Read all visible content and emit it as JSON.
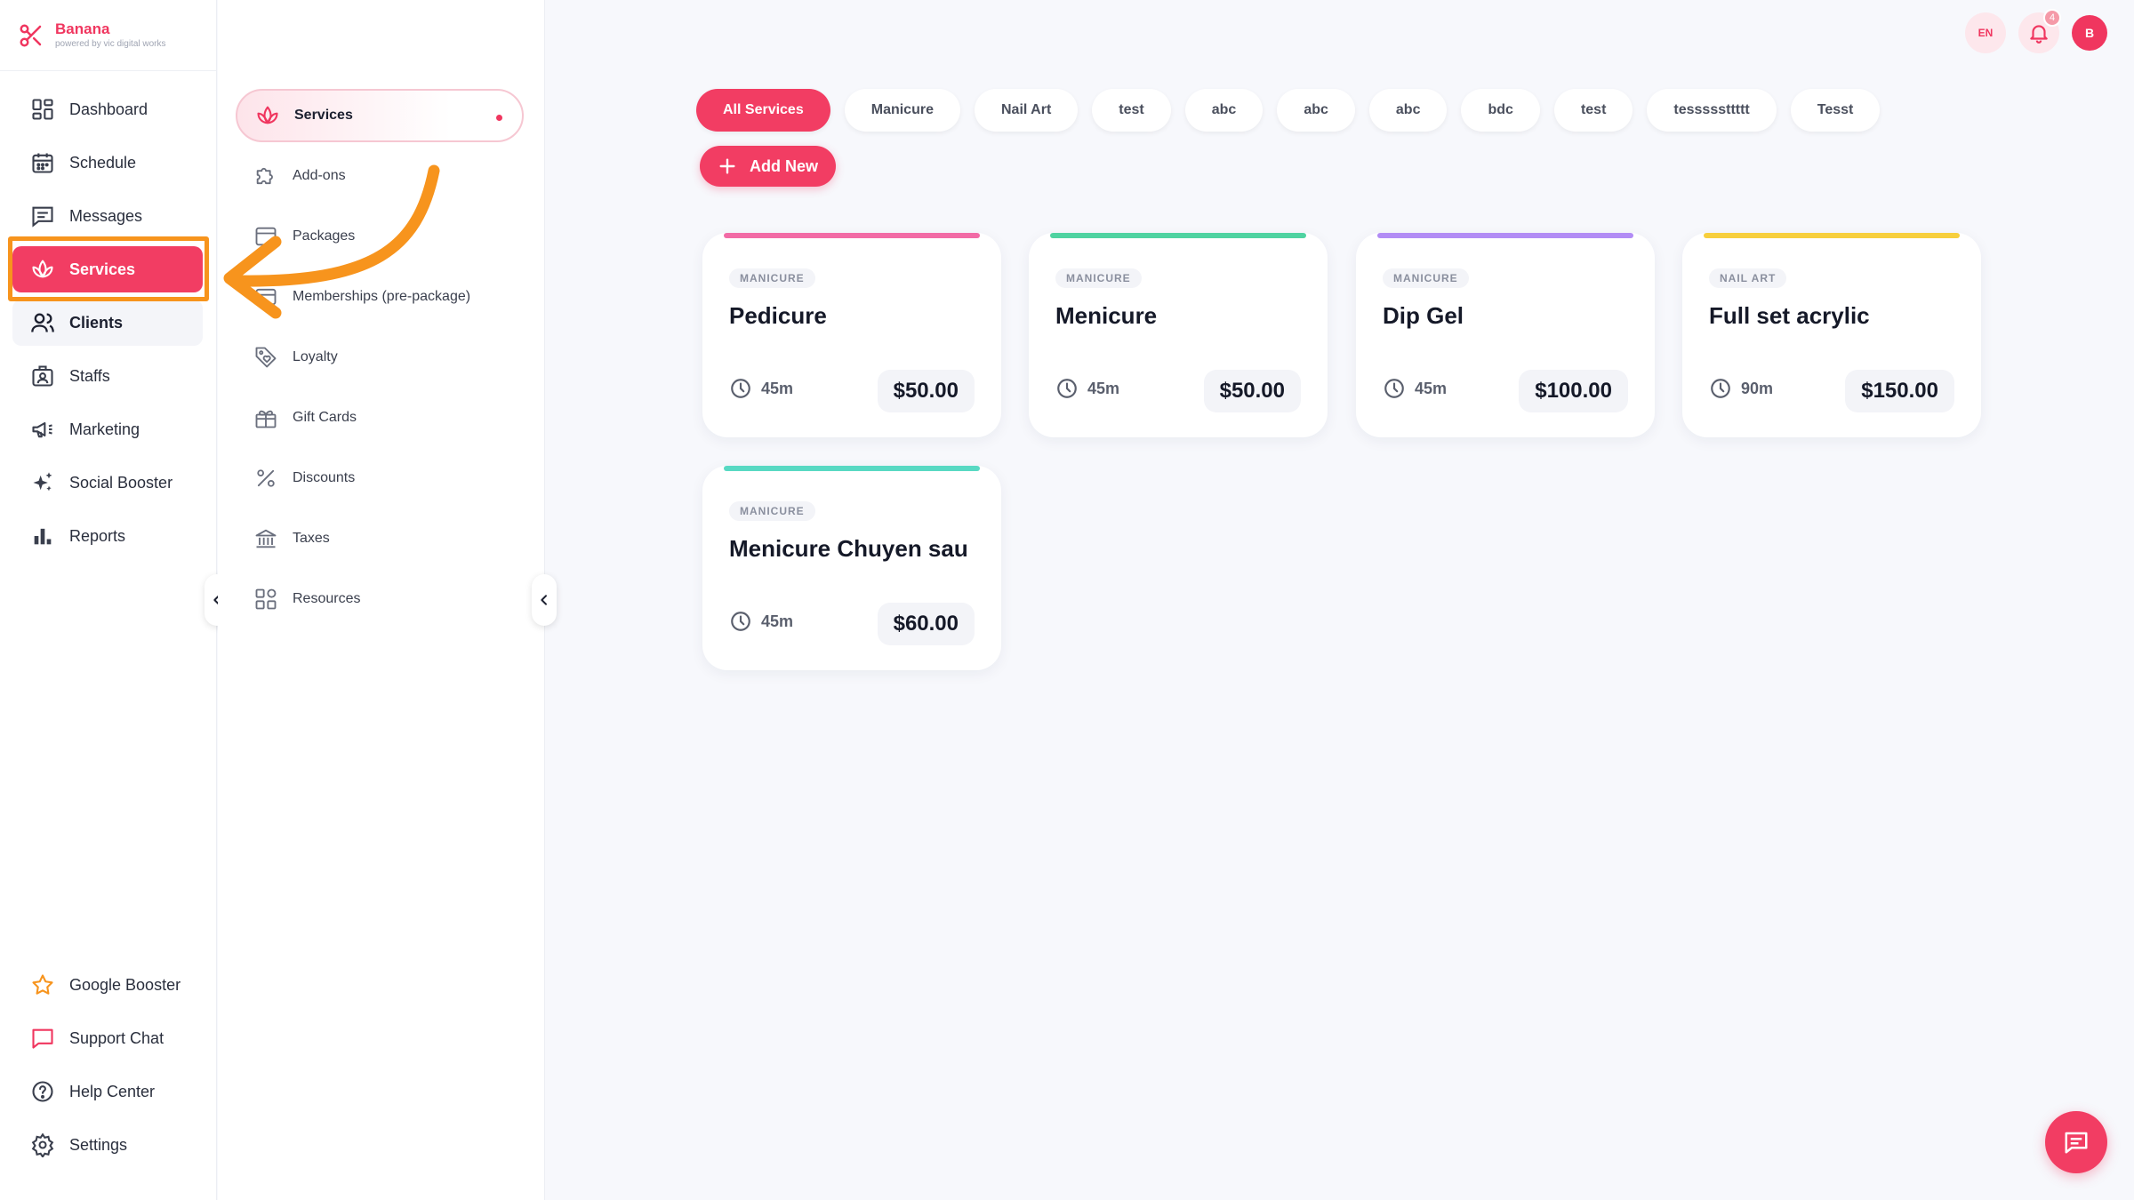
{
  "brand": {
    "name": "Banana",
    "tagline": "powered by vic digital works"
  },
  "sidebar": {
    "items": [
      {
        "label": "Dashboard",
        "icon": "dashboard-icon"
      },
      {
        "label": "Schedule",
        "icon": "calendar-icon"
      },
      {
        "label": "Messages",
        "icon": "message-icon"
      },
      {
        "label": "Services",
        "icon": "lotus-icon"
      },
      {
        "label": "Clients",
        "icon": "users-icon"
      },
      {
        "label": "Staffs",
        "icon": "staff-icon"
      },
      {
        "label": "Marketing",
        "icon": "megaphone-icon"
      },
      {
        "label": "Social Booster",
        "icon": "sparkle-icon"
      },
      {
        "label": "Reports",
        "icon": "bar-chart-icon"
      }
    ],
    "bottom_items": [
      {
        "label": "Google Booster",
        "icon": "star-icon"
      },
      {
        "label": "Support Chat",
        "icon": "chat-icon"
      },
      {
        "label": "Help Center",
        "icon": "help-icon"
      },
      {
        "label": "Settings",
        "icon": "gear-icon"
      }
    ]
  },
  "subnav": {
    "items": [
      {
        "label": "Services",
        "icon": "lotus-icon"
      },
      {
        "label": "Add-ons",
        "icon": "puzzle-icon"
      },
      {
        "label": "Packages",
        "icon": "package-icon"
      },
      {
        "label": "Memberships (pre-package)",
        "icon": "membership-icon"
      },
      {
        "label": "Loyalty",
        "icon": "tag-heart-icon"
      },
      {
        "label": "Gift Cards",
        "icon": "gift-icon"
      },
      {
        "label": "Discounts",
        "icon": "percent-icon"
      },
      {
        "label": "Taxes",
        "icon": "bank-icon"
      },
      {
        "label": "Resources",
        "icon": "grid-icon"
      }
    ]
  },
  "header": {
    "language": "EN",
    "notification_count": "4",
    "avatar_initial": "B"
  },
  "filters": {
    "chips": [
      "All Services",
      "Manicure",
      "Nail Art",
      "test",
      "abc",
      "abc",
      "abc",
      "bdc",
      "test",
      "tesssssttttt",
      "Tesst"
    ],
    "add_new_label": "Add New"
  },
  "services": [
    {
      "category": "MANICURE",
      "name": "Pedicure",
      "duration": "45m",
      "price": "$50.00",
      "color": "#f26ba6"
    },
    {
      "category": "MANICURE",
      "name": "Menicure",
      "duration": "45m",
      "price": "$50.00",
      "color": "#4fd3a1"
    },
    {
      "category": "MANICURE",
      "name": "Dip Gel",
      "duration": "45m",
      "price": "$100.00",
      "color": "#b28cf5"
    },
    {
      "category": "NAIL ART",
      "name": "Full set acrylic",
      "duration": "90m",
      "price": "$150.00",
      "color": "#f7cf3d"
    },
    {
      "category": "MANICURE",
      "name": "Menicure Chuyen sau",
      "duration": "45m",
      "price": "$60.00",
      "color": "#58d9c3"
    }
  ],
  "colors": {
    "accent": "#f23d63",
    "annotation": "#f7941d"
  }
}
